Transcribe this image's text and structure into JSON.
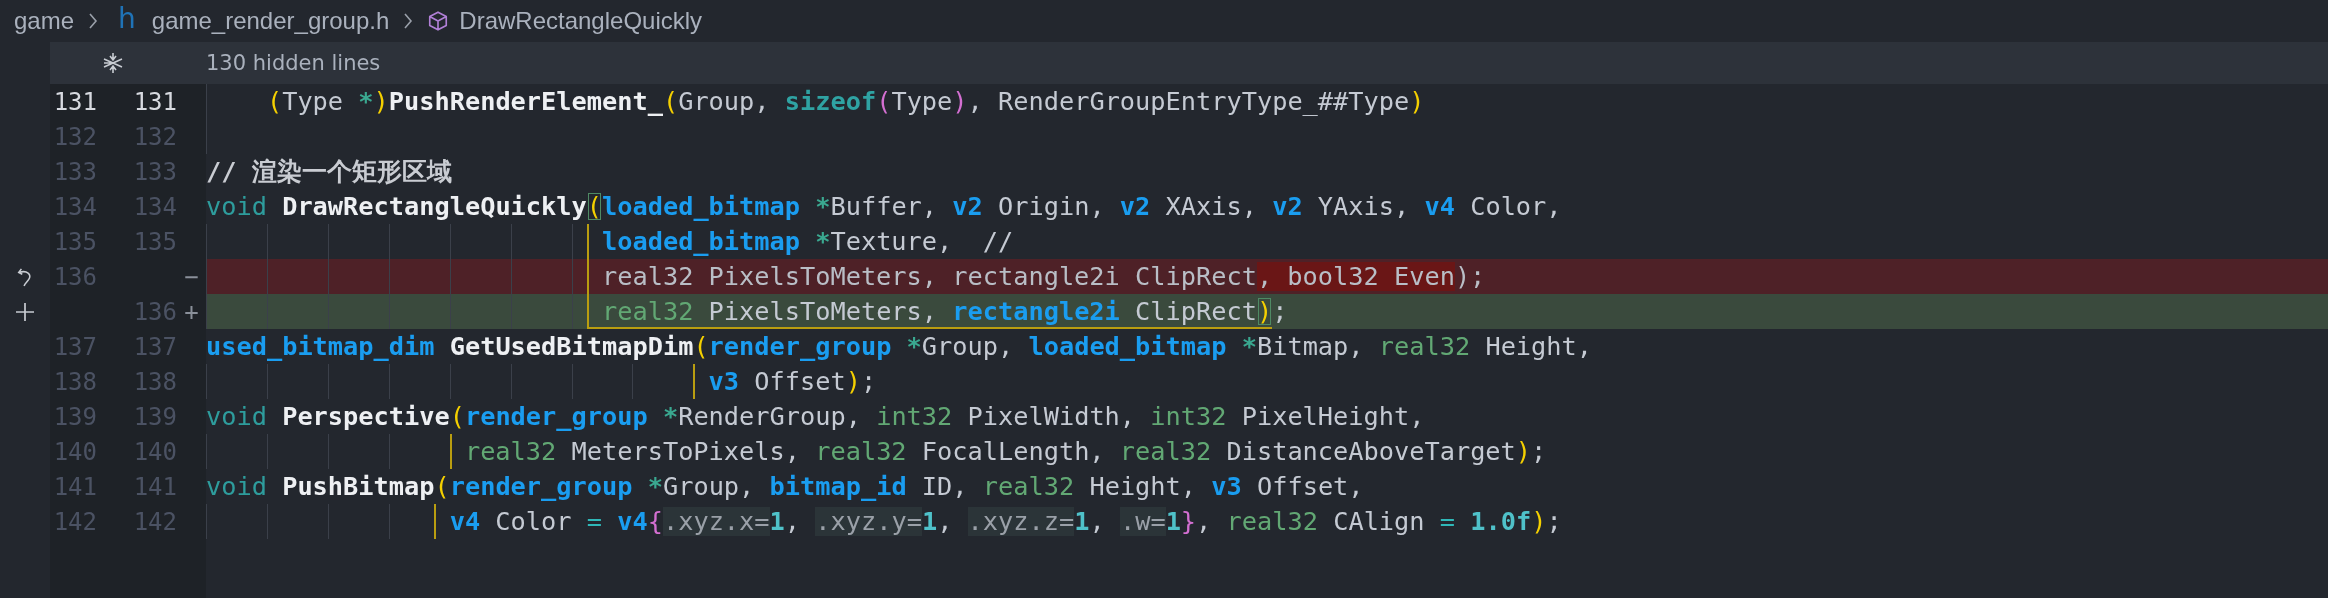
{
  "breadcrumb": {
    "items": [
      {
        "kind": "folder",
        "label": "game"
      },
      {
        "kind": "file",
        "icon": "h",
        "label": "game_render_group.h"
      },
      {
        "kind": "symbol",
        "label": "DrawRectangleQuickly"
      }
    ]
  },
  "hidden_lines": {
    "label": "130 hidden lines"
  },
  "lines": [
    {
      "kind": "context",
      "orig": "131",
      "mod": "131",
      "current": true,
      "bracket_guide": false,
      "bracket_end": false,
      "tokens": [
        {
          "text": "    (",
          "kind": "paren"
        },
        {
          "text": "Type ",
          "kind": "plain"
        },
        {
          "text": "*",
          "kind": "star"
        },
        {
          "text": ")",
          "kind": "paren"
        },
        {
          "text": "PushRenderElement_",
          "kind": "fn"
        },
        {
          "text": "(",
          "kind": "paren"
        },
        {
          "text": "Group, ",
          "kind": "plain"
        },
        {
          "text": "sizeof",
          "kind": "kw2"
        },
        {
          "text": "(",
          "kind": "paren2"
        },
        {
          "text": "Type",
          "kind": "plain"
        },
        {
          "text": ")",
          "kind": "paren2"
        },
        {
          "text": ", RenderGroupEntryType_##Type",
          "kind": "plain"
        },
        {
          "text": ")",
          "kind": "paren"
        }
      ]
    },
    {
      "kind": "context",
      "orig": "132",
      "mod": "132",
      "current": false,
      "bracket_guide": false,
      "bracket_end": false
    },
    {
      "kind": "context",
      "orig": "133",
      "mod": "133",
      "current": false,
      "bracket_guide": false,
      "bracket_end": false,
      "tokens": [
        {
          "text": "// 渲染一个矩形区域",
          "kind": "comment"
        }
      ]
    },
    {
      "kind": "context",
      "orig": "134",
      "mod": "134",
      "current": false,
      "bracket_guide": false,
      "bracket_end": false,
      "tokens": [
        {
          "text": "void ",
          "kind": "kw"
        },
        {
          "text": "DrawRectangleQuickly",
          "kind": "fn"
        },
        {
          "text": "(",
          "kind": "paren_match"
        },
        {
          "text": "loaded_bitmap ",
          "kind": "type"
        },
        {
          "text": "*",
          "kind": "star"
        },
        {
          "text": "Buffer, ",
          "kind": "plain"
        },
        {
          "text": "v2",
          "kind": "type"
        },
        {
          "text": " Origin, ",
          "kind": "plain"
        },
        {
          "text": "v2",
          "kind": "type"
        },
        {
          "text": " XAxis, ",
          "kind": "plain"
        },
        {
          "text": "v2",
          "kind": "type"
        },
        {
          "text": " YAxis, ",
          "kind": "plain"
        },
        {
          "text": "v4",
          "kind": "type"
        },
        {
          "text": " Color,",
          "kind": "plain"
        }
      ]
    },
    {
      "kind": "context",
      "orig": "135",
      "mod": "135",
      "current": false,
      "bracket_guide": true,
      "bracket_end": false,
      "tokens": [
        {
          "text": "                          loaded_bitmap ",
          "kind": "type"
        },
        {
          "text": "*",
          "kind": "star"
        },
        {
          "text": "Texture,  //",
          "kind": "plain"
        }
      ]
    },
    {
      "kind": "deleted",
      "orig": "136",
      "marker": "−",
      "current": false,
      "bracket_guide": true,
      "bracket_end": false,
      "tokens": [
        {
          "text": "                          real32 PixelsToMeters, rectangle2i ClipRect",
          "kind": "plain"
        },
        {
          "text": ", bool32 Even",
          "kind": "removed"
        },
        {
          "text": ");",
          "kind": "plain"
        }
      ]
    },
    {
      "kind": "inserted",
      "mod": "136",
      "marker": "+",
      "current": false,
      "bracket_guide": true,
      "bracket_end": true,
      "tokens": [
        {
          "text": "                          real32",
          "kind": "prim"
        },
        {
          "text": " PixelsToMeters, ",
          "kind": "plain"
        },
        {
          "text": "rectangle2i",
          "kind": "type"
        },
        {
          "text": " ClipRect",
          "kind": "plain"
        },
        {
          "text": ")",
          "kind": "paren_match"
        },
        {
          "text": ";",
          "kind": "plain"
        }
      ]
    },
    {
      "kind": "context",
      "orig": "137",
      "mod": "137",
      "current": false,
      "bracket_guide": false,
      "bracket_end": false,
      "tokens": [
        {
          "text": "used_bitmap_dim ",
          "kind": "type"
        },
        {
          "text": "GetUsedBitmapDim",
          "kind": "fn"
        },
        {
          "text": "(",
          "kind": "paren"
        },
        {
          "text": "render_group ",
          "kind": "type"
        },
        {
          "text": "*",
          "kind": "star"
        },
        {
          "text": "Group, ",
          "kind": "plain"
        },
        {
          "text": "loaded_bitmap ",
          "kind": "type"
        },
        {
          "text": "*",
          "kind": "star"
        },
        {
          "text": "Bitmap, ",
          "kind": "plain"
        },
        {
          "text": "real32",
          "kind": "prim"
        },
        {
          "text": " Height,",
          "kind": "plain"
        }
      ]
    },
    {
      "kind": "context",
      "orig": "138",
      "mod": "138",
      "current": false,
      "bracket_guide": true,
      "bracket_end": false,
      "tokens": [
        {
          "text": "                                 v3",
          "kind": "type"
        },
        {
          "text": " Offset",
          "kind": "plain"
        },
        {
          "text": ")",
          "kind": "paren"
        },
        {
          "text": ";",
          "kind": "plain"
        }
      ]
    },
    {
      "kind": "context",
      "orig": "139",
      "mod": "139",
      "current": false,
      "bracket_guide": false,
      "bracket_end": false,
      "tokens": [
        {
          "text": "void ",
          "kind": "kw"
        },
        {
          "text": "Perspective",
          "kind": "fn"
        },
        {
          "text": "(",
          "kind": "paren"
        },
        {
          "text": "render_group ",
          "kind": "type"
        },
        {
          "text": "*",
          "kind": "star"
        },
        {
          "text": "RenderGroup, ",
          "kind": "plain"
        },
        {
          "text": "int32",
          "kind": "prim"
        },
        {
          "text": " PixelWidth, ",
          "kind": "plain"
        },
        {
          "text": "int32",
          "kind": "prim"
        },
        {
          "text": " PixelHeight,",
          "kind": "plain"
        }
      ]
    },
    {
      "kind": "context",
      "orig": "140",
      "mod": "140",
      "current": false,
      "bracket_guide": true,
      "bracket_end": false,
      "tokens": [
        {
          "text": "                 real32",
          "kind": "prim"
        },
        {
          "text": " MetersToPixels, ",
          "kind": "plain"
        },
        {
          "text": "real32",
          "kind": "prim"
        },
        {
          "text": " FocalLength, ",
          "kind": "plain"
        },
        {
          "text": "real32",
          "kind": "prim"
        },
        {
          "text": " DistanceAboveTarget",
          "kind": "plain"
        },
        {
          "text": ")",
          "kind": "paren"
        },
        {
          "text": ";",
          "kind": "plain"
        }
      ]
    },
    {
      "kind": "context",
      "orig": "141",
      "mod": "141",
      "current": false,
      "bracket_guide": false,
      "bracket_end": false,
      "tokens": [
        {
          "text": "void ",
          "kind": "kw"
        },
        {
          "text": "PushBitmap",
          "kind": "fn"
        },
        {
          "text": "(",
          "kind": "paren"
        },
        {
          "text": "render_group ",
          "kind": "type"
        },
        {
          "text": "*",
          "kind": "star"
        },
        {
          "text": "Group, ",
          "kind": "plain"
        },
        {
          "text": "bitmap_id",
          "kind": "type"
        },
        {
          "text": " ID, ",
          "kind": "plain"
        },
        {
          "text": "real32",
          "kind": "prim"
        },
        {
          "text": " Height, ",
          "kind": "plain"
        },
        {
          "text": "v3",
          "kind": "type"
        },
        {
          "text": " Offset,",
          "kind": "plain"
        }
      ]
    },
    {
      "kind": "context",
      "orig": "142",
      "mod": "142",
      "current": false,
      "bracket_guide": true,
      "bracket_end": false,
      "tokens": [
        {
          "text": "                v4",
          "kind": "type"
        },
        {
          "text": " Color ",
          "kind": "plain"
        },
        {
          "text": "= ",
          "kind": "op"
        },
        {
          "text": "v4",
          "kind": "type"
        },
        {
          "text": "{",
          "kind": "paren2"
        },
        {
          "text": ".xyz.x=",
          "kind": "desig"
        },
        {
          "text": "1",
          "kind": "num"
        },
        {
          "text": ", ",
          "kind": "plain"
        },
        {
          "text": ".xyz.y=",
          "kind": "desig"
        },
        {
          "text": "1",
          "kind": "num"
        },
        {
          "text": ", ",
          "kind": "plain"
        },
        {
          "text": ".xyz.z=",
          "kind": "desig"
        },
        {
          "text": "1",
          "kind": "num"
        },
        {
          "text": ", ",
          "kind": "plain"
        },
        {
          "text": ".w=",
          "kind": "desig"
        },
        {
          "text": "1",
          "kind": "num"
        },
        {
          "text": "}",
          "kind": "paren2"
        },
        {
          "text": ", ",
          "kind": "plain"
        },
        {
          "text": "real32",
          "kind": "prim"
        },
        {
          "text": " CAlign ",
          "kind": "plain"
        },
        {
          "text": "= ",
          "kind": "op"
        },
        {
          "text": "1.0f",
          "kind": "num"
        },
        {
          "text": ")",
          "kind": "paren"
        },
        {
          "text": ";",
          "kind": "plain"
        }
      ]
    }
  ]
}
